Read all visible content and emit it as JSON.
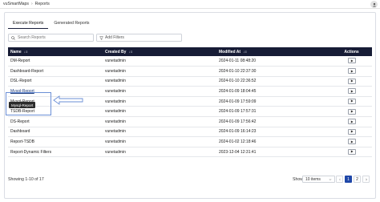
{
  "breadcrumb": {
    "app": "vuSmartMaps",
    "page": "Reports"
  },
  "tabs": [
    {
      "label": "Execute Reports",
      "active": true
    },
    {
      "label": "Generated Reports",
      "active": false
    }
  ],
  "search": {
    "placeholder": "Search Reports"
  },
  "filter": {
    "label": "Add Filters"
  },
  "table": {
    "headers": [
      "Name",
      "Created By",
      "Modified At",
      "Actions"
    ],
    "rows": [
      {
        "name": "DM-Report",
        "created_by": "vunetadmin",
        "modified_at": "2024-01-11 08:48:20"
      },
      {
        "name": "Dashboard-Report",
        "created_by": "vunetadmin",
        "modified_at": "2024-01-10 22:37:30"
      },
      {
        "name": "DSL-Report",
        "created_by": "vunetadmin",
        "modified_at": "2024-01-10 22:36:52"
      },
      {
        "name": "Mysql-Report",
        "created_by": "vunetadmin",
        "modified_at": "2024-01-09 18:04:45"
      },
      {
        "name": "Mysql-Report",
        "created_by": "vunetadmin",
        "modified_at": "2024-01-09 17:59:09"
      },
      {
        "name": "TSDB-Report",
        "created_by": "vunetadmin",
        "modified_at": "2024-01-09 17:57:31"
      },
      {
        "name": "DS-Report",
        "created_by": "vunetadmin",
        "modified_at": "2024-01-09 17:56:42"
      },
      {
        "name": "Dashboard",
        "created_by": "vunetadmin",
        "modified_at": "2024-01-09 16:14:23"
      },
      {
        "name": "Report-TSDB",
        "created_by": "vunetadmin",
        "modified_at": "2024-01-02 12:18:46"
      },
      {
        "name": "Report-Dynamic Filters",
        "created_by": "vunetadmin",
        "modified_at": "2023-12-04 12:31:41"
      }
    ]
  },
  "tooltip": {
    "text": "Mysql-Report"
  },
  "footer": {
    "showing": "Showing 1-10 of 17",
    "show_label": "Show",
    "page_size": "10 items",
    "pages": [
      "1",
      "2"
    ]
  },
  "colors": {
    "header_bg": "#171c36",
    "active_page": "#1f47a8",
    "highlight": "#6b8fd6"
  }
}
